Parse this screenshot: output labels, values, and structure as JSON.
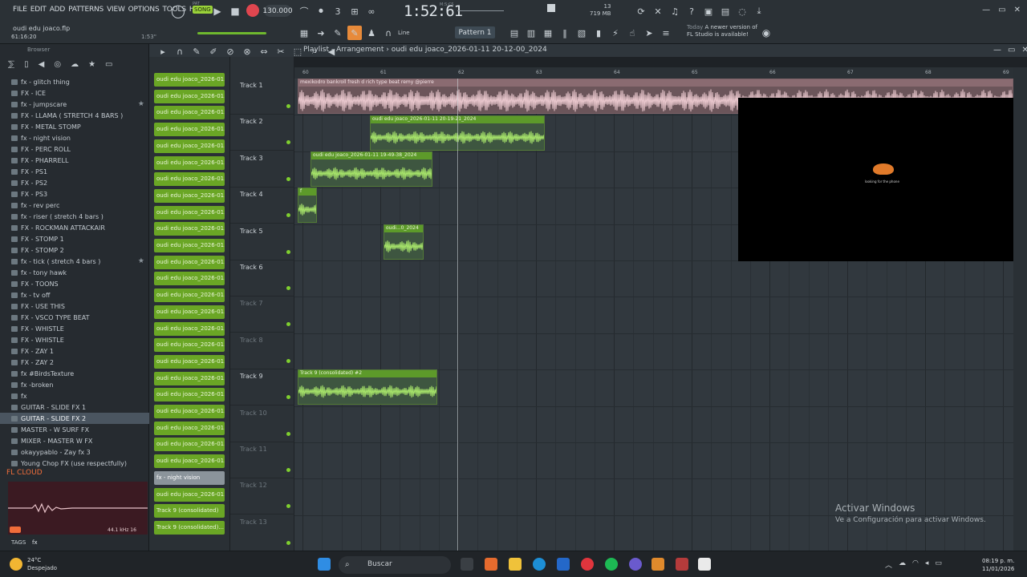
{
  "menu": [
    "FILE",
    "EDIT",
    "ADD",
    "PATTERNS",
    "VIEW",
    "OPTIONS",
    "TOOLS",
    "HELP"
  ],
  "transport": {
    "pat_label": "PAT",
    "song_label": "SONG",
    "tempo": "130.000",
    "time": "1:52:61",
    "time_label": "M:S:CS"
  },
  "cpu": {
    "cores": "13",
    "memory": "719 MB",
    "zero": "0"
  },
  "project": {
    "filename": "oudi edu joaco.flp",
    "time": "61:16:20",
    "hint_time": "1:53\""
  },
  "toolbar": {
    "line_mode": "Line",
    "pattern": "Pattern 1"
  },
  "news": {
    "line1_dim": "Today",
    "line1": "A newer version of",
    "line2": "FL Studio is available!"
  },
  "browser": {
    "title": "Browser",
    "items": [
      {
        "label": "fx - glitch thing",
        "star": false,
        "sel": false
      },
      {
        "label": "FX - ICE",
        "star": false,
        "sel": false
      },
      {
        "label": "fx - jumpscare",
        "star": true,
        "sel": false
      },
      {
        "label": "FX - LLAMA ( STRETCH 4 BARS )",
        "star": false,
        "sel": false
      },
      {
        "label": "FX - METAL STOMP",
        "star": false,
        "sel": false
      },
      {
        "label": "fx - night vision",
        "star": false,
        "sel": false
      },
      {
        "label": "FX - PERC ROLL",
        "star": false,
        "sel": false
      },
      {
        "label": "FX - PHARRELL",
        "star": false,
        "sel": false
      },
      {
        "label": "FX - PS1",
        "star": false,
        "sel": false
      },
      {
        "label": "FX - PS2",
        "star": false,
        "sel": false
      },
      {
        "label": "FX - PS3",
        "star": false,
        "sel": false
      },
      {
        "label": "fx - rev perc",
        "star": false,
        "sel": false
      },
      {
        "label": "fx - riser ( stretch 4 bars )",
        "star": false,
        "sel": false
      },
      {
        "label": "FX - ROCKMAN ATTACKAIR",
        "star": false,
        "sel": false
      },
      {
        "label": "FX - STOMP 1",
        "star": false,
        "sel": false
      },
      {
        "label": "FX - STOMP 2",
        "star": false,
        "sel": false
      },
      {
        "label": "fx - tick ( stretch 4 bars )",
        "star": true,
        "sel": false
      },
      {
        "label": "fx - tony hawk",
        "star": false,
        "sel": false
      },
      {
        "label": "FX - TOONS",
        "star": false,
        "sel": false
      },
      {
        "label": "fx - tv off",
        "star": false,
        "sel": false
      },
      {
        "label": "FX - USE THIS",
        "star": false,
        "sel": false
      },
      {
        "label": "FX - VSCO TYPE BEAT",
        "star": false,
        "sel": false
      },
      {
        "label": "FX - WHISTLE",
        "star": false,
        "sel": false
      },
      {
        "label": "FX - WHISTLE",
        "star": false,
        "sel": false
      },
      {
        "label": "FX - ZAY 1",
        "star": false,
        "sel": false
      },
      {
        "label": "FX - ZAY 2",
        "star": false,
        "sel": false
      },
      {
        "label": "fx #BirdsTexture",
        "star": false,
        "sel": false
      },
      {
        "label": "fx -broken",
        "star": false,
        "sel": false
      },
      {
        "label": "fx",
        "star": false,
        "sel": false
      },
      {
        "label": "GUITAR - SLIDE FX 1",
        "star": false,
        "sel": false
      },
      {
        "label": "GUITAR - SLIDE FX 2",
        "star": false,
        "sel": true
      },
      {
        "label": "MASTER - W SURF FX",
        "star": false,
        "sel": false
      },
      {
        "label": "MIXER - MASTER W FX",
        "star": false,
        "sel": false
      },
      {
        "label": "okayypablo - Zay fx 3",
        "star": false,
        "sel": false
      },
      {
        "label": "Young Chop FX (use respectfully)",
        "star": false,
        "sel": false
      }
    ],
    "cloud": "FL CLOUD",
    "wave_info": "44.1 kHz 16",
    "tags_label": "TAGS",
    "tags_value": "fx"
  },
  "playlist": {
    "title": "Playlist - Arrangement",
    "arrangement": "oudi edu joaco_2026-01-11 20-12-00_2024",
    "bars": [
      "60",
      "61",
      "62",
      "63",
      "64",
      "65",
      "66",
      "67",
      "68",
      "69"
    ],
    "clip_buttons": [
      "oudi edu joaco_2026-01...",
      "oudi edu joaco_2026-01...",
      "oudi edu joaco_2026-01...",
      "oudi edu joaco_2026-01...",
      "oudi edu joaco_2026-01...",
      "oudi edu joaco_2026-01...",
      "oudi edu joaco_2026-01...",
      "oudi edu joaco_2026-01...",
      "oudi edu joaco_2026-01...",
      "oudi edu joaco_2026-01...",
      "oudi edu joaco_2026-01...",
      "oudi edu joaco_2026-01...",
      "oudi edu joaco_2026-01...",
      "oudi edu joaco_2026-01...",
      "oudi edu joaco_2026-01...",
      "oudi edu joaco_2026-01...",
      "oudi edu joaco_2026-01...",
      "oudi edu joaco_2026-01...",
      "oudi edu joaco_2026-01...",
      "oudi edu joaco_2026-01...",
      "oudi edu joaco_2026-01...",
      "oudi edu joaco_2026-01...",
      "oudi edu joaco_2026-01...",
      "oudi edu joaco_2026-01...",
      "fx - night vision",
      "oudi edu joaco_2026-01...",
      "Track 9 (consolidated)",
      "Track 9 (consolidated)..."
    ],
    "tracks": [
      {
        "name": "Track 1",
        "dim": false
      },
      {
        "name": "Track 2",
        "dim": false
      },
      {
        "name": "Track 3",
        "dim": false
      },
      {
        "name": "Track 4",
        "dim": false
      },
      {
        "name": "Track 5",
        "dim": false
      },
      {
        "name": "Track 6",
        "dim": false
      },
      {
        "name": "Track 7",
        "dim": true
      },
      {
        "name": "Track 8",
        "dim": true
      },
      {
        "name": "Track 9",
        "dim": false
      },
      {
        "name": "Track 10",
        "dim": true
      },
      {
        "name": "Track 11",
        "dim": true
      },
      {
        "name": "Track 12",
        "dim": true
      },
      {
        "name": "Track 13",
        "dim": true
      }
    ],
    "clips": [
      {
        "label": "mexikodro  bankroll fresh  d rich type beat remy @pierre",
        "pink": true
      },
      {
        "label": "oudi edu joaco_2026-01-11 20-19-21_2024",
        "pink": false
      },
      {
        "label": "oudi edu joaco_2026-01-11 19-49-38_2024",
        "pink": false
      },
      {
        "label": "f",
        "pink": false
      },
      {
        "label": "oudi...0_2024",
        "pink": false
      },
      {
        "label": "Track 9 (consolidated) #2",
        "pink": false
      }
    ],
    "overlay_text": "looking for the phone"
  },
  "activation": {
    "title": "Activar Windows",
    "subtitle": "Ve a Configuración para activar Windows."
  },
  "taskbar": {
    "temp": "24°C",
    "weather": "Despejado",
    "search": "Buscar",
    "time": "08:19 p. m.",
    "date": "11/01/2026"
  },
  "colors": {
    "accent_green": "#6aa625",
    "record_red": "#e0464f",
    "cloud_orange": "#ef6d3a"
  }
}
